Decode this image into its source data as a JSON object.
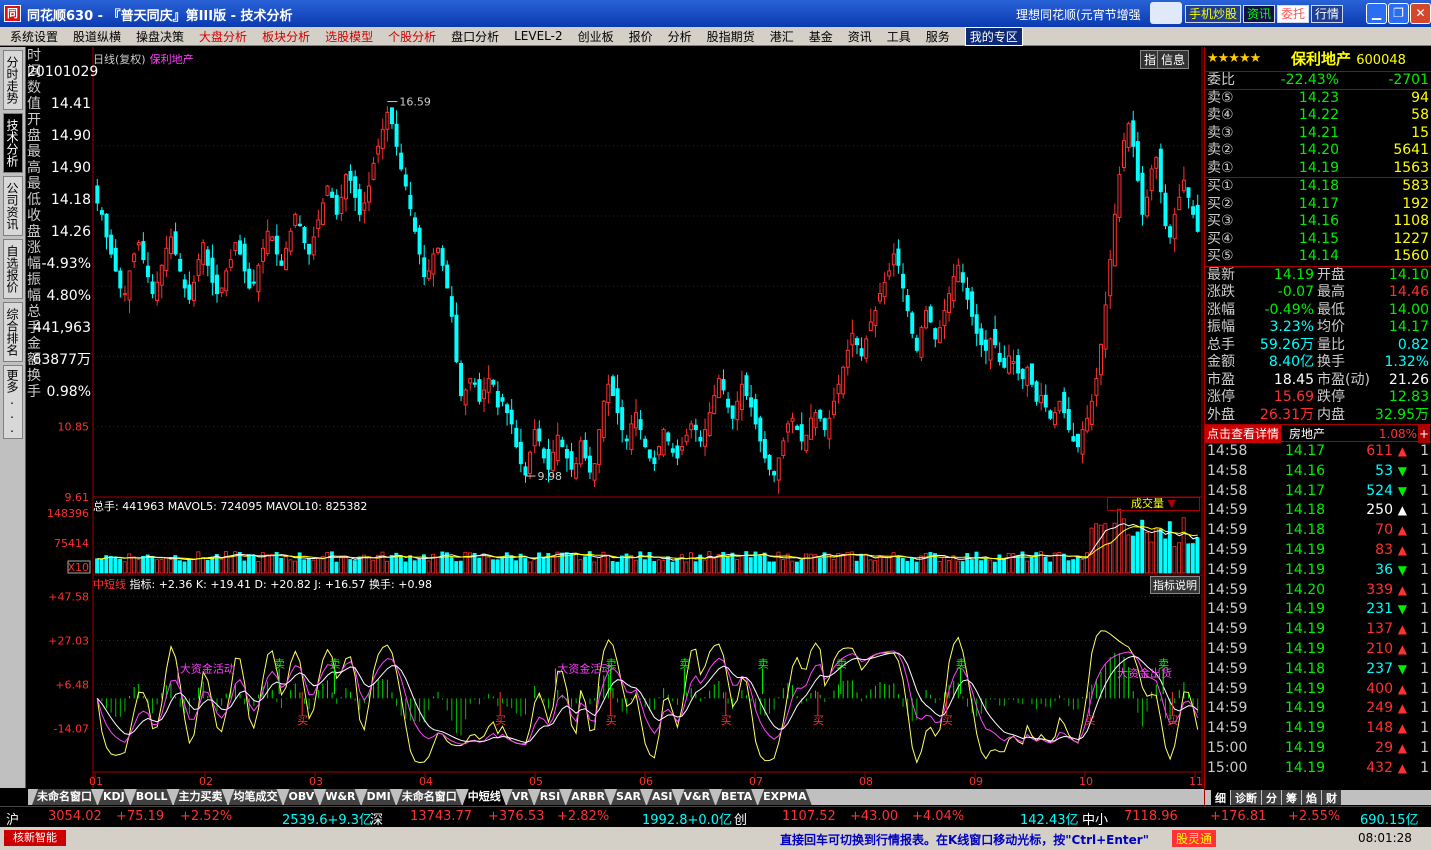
{
  "window": {
    "title": "同花顺630 - 『普天同庆』第III版 - 技术分析",
    "slogan": "理想同花顺(元宵节增强",
    "buttons": [
      "手机炒股",
      "资讯",
      "委托",
      "行情"
    ],
    "logo_char": "同"
  },
  "menu": {
    "items": [
      {
        "label": "系统设置",
        "hot": false
      },
      {
        "label": "股道纵横",
        "hot": false
      },
      {
        "label": "操盘决策",
        "hot": false
      },
      {
        "label": "大盘分析",
        "hot": true
      },
      {
        "label": "板块分析",
        "hot": true
      },
      {
        "label": "选股模型",
        "hot": true
      },
      {
        "label": "个股分析",
        "hot": true
      },
      {
        "label": "盘口分析",
        "hot": false
      },
      {
        "label": "LEVEL-2",
        "hot": false
      },
      {
        "label": "创业板",
        "hot": false
      },
      {
        "label": "报价",
        "hot": false
      },
      {
        "label": "分析",
        "hot": false
      },
      {
        "label": "股指期货",
        "hot": false
      },
      {
        "label": "港汇",
        "hot": false
      },
      {
        "label": "基金",
        "hot": false
      },
      {
        "label": "资讯",
        "hot": false
      },
      {
        "label": "工具",
        "hot": false
      },
      {
        "label": "服务",
        "hot": false
      }
    ],
    "home": "我的专区"
  },
  "left_tabs": [
    "分时走势",
    "技术分析",
    "公司资讯",
    "自选报价",
    "综合排名",
    "更多..."
  ],
  "data_panel": {
    "rows": [
      {
        "label": "时间",
        "value": "20101029",
        "color": "white"
      },
      {
        "label": "数值",
        "value": "14.41",
        "color": "red"
      },
      {
        "label": "开盘",
        "value": "14.90",
        "color": "red"
      },
      {
        "label": "最高",
        "value": "14.90",
        "color": "red"
      },
      {
        "label": "最低",
        "value": "14.18",
        "color": "green"
      },
      {
        "label": "收盘",
        "value": "14.26",
        "color": "green"
      },
      {
        "label": "涨幅",
        "value": "-4.93%",
        "color": "green"
      },
      {
        "label": "振幅",
        "value": "4.80%",
        "color": "cyan"
      },
      {
        "label": "总手",
        "value": "441,963",
        "color": "white"
      },
      {
        "label": "金额",
        "value": "63877万",
        "color": "cyan"
      },
      {
        "label": "换手",
        "value": "0.98%",
        "color": "cyan"
      }
    ]
  },
  "chart_header": {
    "period": "日线(复权)",
    "stock": "保利地产",
    "btn1": "指",
    "btn2": "信息"
  },
  "volume_header": {
    "text": "总手: 441963  MAVOL5: 724095  MAVOL10: 825382",
    "selector": "成交量"
  },
  "indicator_header": {
    "name": "中短线",
    "text": "指标: +2.36  K: +19.41  D: +20.82  J: +16.57  换手: +0.98",
    "help": "指标说明"
  },
  "bottom_tabs": [
    "未命名窗口",
    "KDJ",
    "BOLL",
    "主力买卖",
    "均笔成交",
    "OBV",
    "W&R",
    "DMI",
    "未命名窗口",
    "中短线",
    "VR",
    "RSI",
    "ARBR",
    "SAR",
    "ASI",
    "V&R",
    "BETA",
    "EXPMA"
  ],
  "active_tab": "中短线",
  "chart_data": [
    {
      "type": "candlestick",
      "title": "保利地产 日线(复权)",
      "x_ticks": [
        "01",
        "02",
        "03",
        "04",
        "05",
        "06",
        "07",
        "08",
        "09",
        "10",
        "11"
      ],
      "y_ticks": [
        "9.61",
        "10.85"
      ],
      "ylim": [
        9.61,
        17.2
      ],
      "annotations": [
        {
          "label": "16.59",
          "value": 16.59
        },
        {
          "label": "9.98",
          "value": 9.98
        }
      ],
      "closes": [
        14.8,
        14.6,
        14.2,
        13.9,
        13.6,
        13.3,
        13.2,
        13.6,
        13.9,
        14.1,
        13.8,
        13.5,
        13.2,
        13.4,
        13.7,
        14.0,
        14.2,
        13.9,
        13.6,
        13.3,
        13.1,
        13.4,
        13.8,
        14.1,
        13.7,
        13.4,
        13.2,
        13.3,
        13.6,
        13.8,
        14.1,
        13.9,
        13.6,
        13.3,
        13.4,
        13.7,
        14.0,
        14.3,
        14.2,
        13.9,
        13.7,
        14.0,
        14.3,
        14.6,
        14.4,
        14.1,
        13.9,
        14.2,
        14.5,
        14.8,
        15.1,
        14.9,
        14.6,
        14.9,
        15.3,
        15.2,
        14.9,
        14.6,
        14.8,
        15.1,
        15.5,
        15.8,
        16.1,
        16.4,
        16.2,
        15.8,
        15.4,
        15.1,
        14.7,
        14.3,
        13.9,
        13.5,
        13.6,
        13.9,
        14.0,
        13.7,
        13.3,
        12.8,
        12.0,
        11.4,
        11.5,
        11.7,
        11.6,
        11.3,
        11.5,
        11.7,
        11.6,
        11.2,
        11.3,
        11.1,
        10.9,
        10.5,
        10.2,
        10.0,
        10.4,
        10.8,
        10.6,
        10.3,
        10.1,
        10.4,
        10.7,
        10.5,
        10.3,
        10.1,
        10.2,
        10.6,
        10.3,
        10.05,
        10.2,
        10.8,
        11.3,
        11.6,
        11.4,
        11.1,
        10.8,
        10.6,
        10.9,
        11.1,
        10.8,
        10.5,
        10.3,
        10.2,
        10.5,
        10.8,
        10.6,
        10.4,
        10.3,
        10.5,
        10.7,
        10.9,
        10.8,
        10.6,
        10.8,
        11.1,
        11.4,
        11.7,
        11.5,
        11.2,
        11.0,
        11.3,
        11.6,
        11.4,
        11.2,
        10.9,
        10.6,
        10.3,
        10.1,
        10.0,
        10.3,
        10.6,
        10.9,
        11.0,
        10.8,
        10.6,
        10.7,
        11.0,
        11.1,
        11.0,
        10.8,
        11.0,
        11.3,
        11.6,
        11.9,
        12.2,
        12.5,
        12.3,
        12.1,
        12.4,
        12.7,
        12.9,
        13.2,
        13.4,
        13.6,
        13.9,
        13.7,
        13.3,
        12.9,
        12.5,
        12.2,
        12.6,
        12.9,
        12.7,
        12.4,
        12.6,
        12.9,
        13.2,
        13.5,
        13.7,
        13.4,
        13.1,
        12.8,
        12.5,
        12.3,
        12.2,
        12.4,
        12.3,
        12.0,
        11.9,
        12.1,
        12.0,
        11.8,
        11.7,
        11.9,
        11.6,
        11.3,
        11.4,
        11.2,
        11.0,
        11.1,
        11.3,
        11.1,
        10.8,
        10.6,
        10.5,
        10.8,
        11.0,
        11.3,
        11.7,
        12.3,
        13.0,
        13.8,
        14.6,
        15.3,
        15.9,
        16.2,
        15.8,
        15.2,
        14.6,
        14.9,
        15.4,
        15.6,
        15.0,
        14.4,
        14.2,
        14.6,
        14.9,
        15.2,
        14.9,
        14.6,
        14.3
      ]
    },
    {
      "type": "bar",
      "title": "成交量",
      "y_ticks": [
        "148396",
        "75414",
        "X10"
      ],
      "ylim": [
        0,
        148396
      ]
    },
    {
      "type": "line",
      "title": "中短线",
      "y_ticks": [
        "+47.58",
        "+27.03",
        "+6.48",
        "-14.07"
      ],
      "ylim": [
        -33,
        52
      ],
      "labels": [
        "大资金活动",
        "卖",
        "买",
        "大资金出货"
      ]
    }
  ],
  "quote": {
    "stars": "★★★★★",
    "name": "保利地产",
    "code": "600048",
    "wb": {
      "label": "委比",
      "pct": "-22.43%",
      "diff": "-2701"
    },
    "asks": [
      {
        "label": "卖⑤",
        "price": "14.23",
        "vol": "94"
      },
      {
        "label": "卖④",
        "price": "14.22",
        "vol": "58"
      },
      {
        "label": "卖③",
        "price": "14.21",
        "vol": "15"
      },
      {
        "label": "卖②",
        "price": "14.20",
        "vol": "5641"
      },
      {
        "label": "卖①",
        "price": "14.19",
        "vol": "1563"
      }
    ],
    "bids": [
      {
        "label": "买①",
        "price": "14.18",
        "vol": "583"
      },
      {
        "label": "买②",
        "price": "14.17",
        "vol": "192"
      },
      {
        "label": "买③",
        "price": "14.16",
        "vol": "1108"
      },
      {
        "label": "买④",
        "price": "14.15",
        "vol": "1227"
      },
      {
        "label": "买⑤",
        "price": "14.14",
        "vol": "1560"
      }
    ],
    "stats": [
      {
        "a": "最新",
        "b": "14.19",
        "bc": "green",
        "m": "开盘",
        "d": "14.10",
        "dc": "green"
      },
      {
        "a": "涨跌",
        "b": "-0.07",
        "bc": "green",
        "m": "最高",
        "d": "14.46",
        "dc": "red"
      },
      {
        "a": "涨幅",
        "b": "-0.49%",
        "bc": "green",
        "m": "最低",
        "d": "14.00",
        "dc": "green"
      },
      {
        "a": "振幅",
        "b": "3.23%",
        "bc": "cyan",
        "m": "均价",
        "d": "14.17",
        "dc": "green"
      },
      {
        "a": "总手",
        "b": "59.26万",
        "bc": "cyan",
        "m": "量比",
        "d": "0.82",
        "dc": "cyan"
      },
      {
        "a": "金额",
        "b": "8.40亿",
        "bc": "cyan",
        "m": "换手",
        "d": "1.32%",
        "dc": "cyan"
      },
      {
        "a": "市盈",
        "b": "18.45",
        "bc": "white",
        "m": "市盈(动)",
        "d": "21.26",
        "dc": "white"
      },
      {
        "a": "涨停",
        "b": "15.69",
        "bc": "red",
        "m": "跌停",
        "d": "12.83",
        "dc": "green"
      },
      {
        "a": "外盘",
        "b": "26.31万",
        "bc": "red",
        "m": "内盘",
        "d": "32.95万",
        "dc": "green"
      }
    ],
    "sector": {
      "link": "点击查看详情",
      "name": "房地产",
      "pct": "1.08%",
      "plus": "+"
    }
  },
  "ticks": [
    {
      "t": "14:58",
      "p": "14.17",
      "v": "611",
      "dir": "up"
    },
    {
      "t": "14:58",
      "p": "14.16",
      "v": "53",
      "dir": "down"
    },
    {
      "t": "14:58",
      "p": "14.17",
      "v": "524",
      "dir": "down"
    },
    {
      "t": "14:59",
      "p": "14.18",
      "v": "250",
      "dir": "white"
    },
    {
      "t": "14:59",
      "p": "14.18",
      "v": "70",
      "dir": "up"
    },
    {
      "t": "14:59",
      "p": "14.19",
      "v": "83",
      "dir": "up"
    },
    {
      "t": "14:59",
      "p": "14.19",
      "v": "36",
      "dir": "down"
    },
    {
      "t": "14:59",
      "p": "14.20",
      "v": "339",
      "dir": "up"
    },
    {
      "t": "14:59",
      "p": "14.19",
      "v": "231",
      "dir": "down"
    },
    {
      "t": "14:59",
      "p": "14.19",
      "v": "137",
      "dir": "up"
    },
    {
      "t": "14:59",
      "p": "14.19",
      "v": "210",
      "dir": "up"
    },
    {
      "t": "14:59",
      "p": "14.18",
      "v": "237",
      "dir": "down"
    },
    {
      "t": "14:59",
      "p": "14.19",
      "v": "400",
      "dir": "up"
    },
    {
      "t": "14:59",
      "p": "14.19",
      "v": "249",
      "dir": "up"
    },
    {
      "t": "14:59",
      "p": "14.19",
      "v": "148",
      "dir": "up"
    },
    {
      "t": "15:00",
      "p": "14.19",
      "v": "29",
      "dir": "up"
    },
    {
      "t": "15:00",
      "p": "14.19",
      "v": "432",
      "dir": "up"
    }
  ],
  "tick_end": "1",
  "right_tabs": [
    "细",
    "诊断",
    "分",
    "筹",
    "焰",
    "财"
  ],
  "status": {
    "sh_label": "沪",
    "sh_idx": "3054.02",
    "sh_chg": "+75.19",
    "sh_pct": "+2.52%",
    "sh_amt": "2539.6+9.3亿",
    "sz_label": "深",
    "sz_idx": "13743.77",
    "sz_chg": "+376.53",
    "sz_pct": "+2.82%",
    "sz_amt": "1992.8+0.0亿",
    "cy_label": "创",
    "cy_idx": "1107.52",
    "cy_chg": "+43.00",
    "cy_pct": "+4.04%",
    "cy_amt": "142.43亿",
    "zx_label": "中小",
    "zx_idx": "7118.96",
    "zx_chg": "+176.81",
    "zx_pct": "+2.55%",
    "zx_amt": "690.15亿"
  },
  "bottom": {
    "logo": "核新智能",
    "scroll": "直接回车可切换到行情报表。在K线窗口移动光标，按\"Ctrl+Enter\"",
    "btn": "股灵通",
    "clock": "08:01:28"
  },
  "colors": {
    "up": "#ff3030",
    "down": "#00ffff",
    "ma": "#ffff00",
    "grid": "#8b0000",
    "frame": "#a00000"
  }
}
